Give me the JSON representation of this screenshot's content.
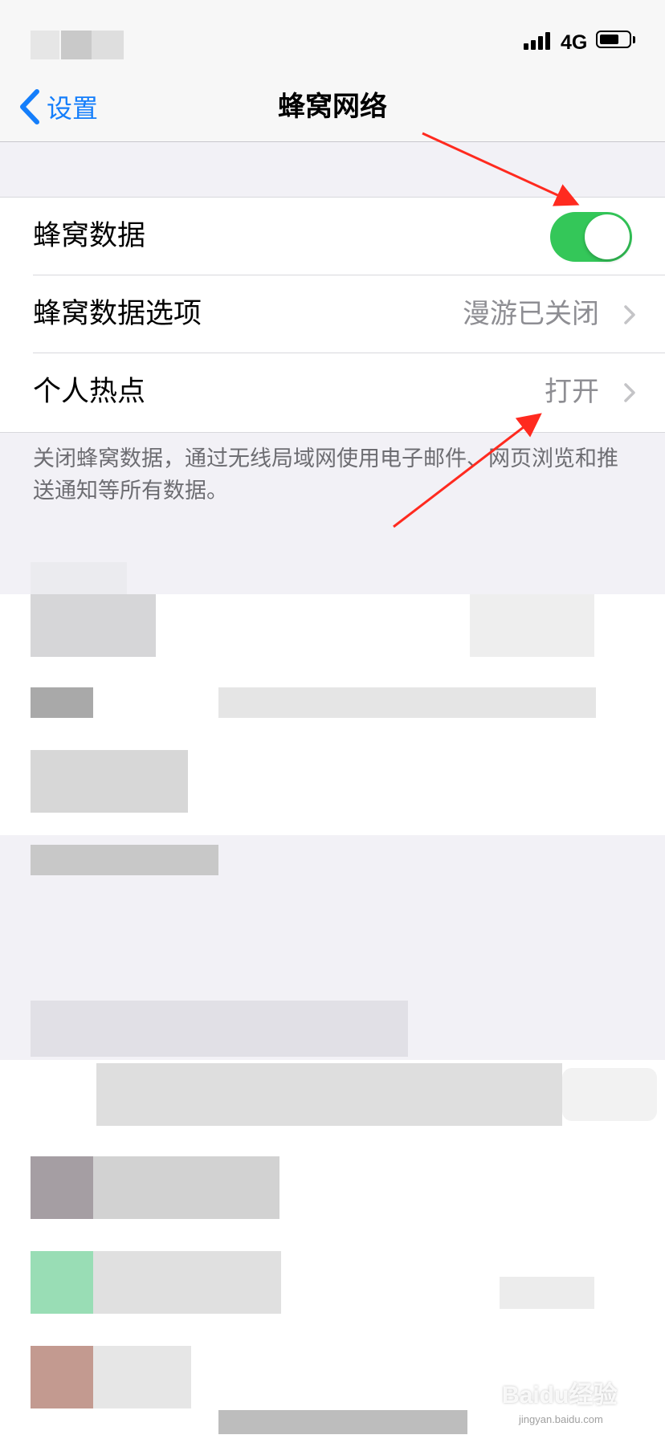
{
  "status_bar": {
    "network": "4G"
  },
  "nav": {
    "back_label": "设置",
    "title": "蜂窝网络"
  },
  "rows": [
    {
      "label": "蜂窝数据",
      "toggle_on": true
    },
    {
      "label": "蜂窝数据选项",
      "value": "漫游已关闭"
    },
    {
      "label": "个人热点",
      "value": "打开"
    }
  ],
  "footer_note": "关闭蜂窝数据，通过无线局域网使用电子邮件、网页浏览和推送通知等所有数据。",
  "watermark": {
    "brand": "Baidu经验",
    "url": "jingyan.baidu.com"
  },
  "colors": {
    "accent": "#147efb",
    "toggle_on": "#34c759",
    "annotation_arrow": "#ff2a1f"
  },
  "icons": {
    "back": "chevron-left-icon",
    "disclosure": "chevron-right-icon"
  }
}
